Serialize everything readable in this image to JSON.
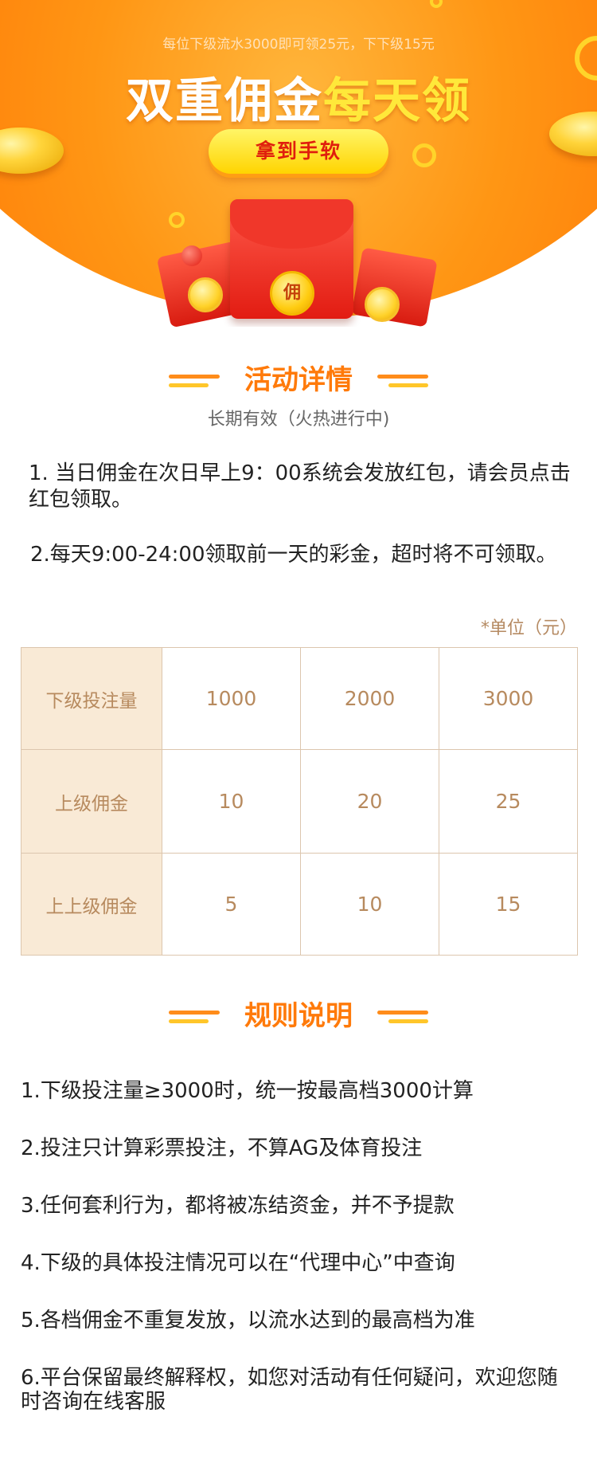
{
  "hero": {
    "subtitle": "每位下级流水3000即可领25元，下下级15元",
    "title_main": "双重佣金",
    "title_highlight": "每天领",
    "button_label": "拿到手软",
    "envelope_glyph": "佣",
    "colors": {
      "orange": "#ff7b08",
      "highlight": "#ffe83a",
      "button": "#ffd400",
      "button_text": "#e01f0d"
    }
  },
  "details": {
    "heading": "活动详情",
    "validity": "长期有效（火热进行中)",
    "paragraphs": [
      "1. 当日佣金在次日早上9：00系统会发放红包，请会员点击红包领取。",
      "2.每天9:00-24:00领取前一天的彩金，超时将不可领取。"
    ],
    "unit_note": "*单位（元）"
  },
  "table": {
    "rows": [
      {
        "header": "下级投注量",
        "values": [
          "1000",
          "2000",
          "3000"
        ]
      },
      {
        "header": "上级佣金",
        "values": [
          "10",
          "20",
          "25"
        ]
      },
      {
        "header": "上上级佣金",
        "values": [
          "5",
          "10",
          "15"
        ]
      }
    ]
  },
  "rules": {
    "heading": "规则说明",
    "items": [
      "1.下级投注量≥3000时，统一按最高档3000计算",
      "2.投注只计算彩票投注，不算AG及体育投注",
      "3.任何套利行为，都将被冻结资金，并不予提款",
      "4.下级的具体投注情况可以在“代理中心”中查询",
      "5.各档佣金不重复发放，以流水达到的最高档为准",
      "6.平台保留最终解释权，如您对活动有任何疑问，欢迎您随时咨询在线客服"
    ]
  },
  "accent_colors": {
    "heading": "#ff7a0a",
    "table_text": "#b78a5e",
    "table_header_bg": "#f9ead6",
    "table_border": "#dcc6ae"
  }
}
